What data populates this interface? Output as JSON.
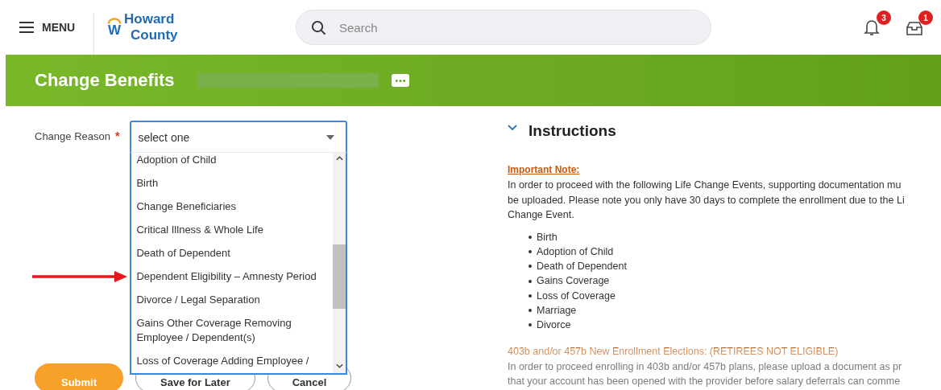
{
  "header": {
    "menu_label": "MENU",
    "logo": {
      "mark": "W",
      "lines": [
        "Howard",
        "County"
      ]
    },
    "search": {
      "placeholder": "Search"
    },
    "notifications": {
      "count": "3"
    },
    "inbox": {
      "count": "1"
    }
  },
  "banner": {
    "title": "Change Benefits"
  },
  "form": {
    "label": "Change Reason",
    "required": true,
    "required_mark": "*",
    "dropdown": {
      "value": "select one",
      "open": true,
      "options": [
        {
          "label": "Adoption of Child",
          "pointed": false
        },
        {
          "label": "Birth",
          "pointed": false
        },
        {
          "label": "Change Beneficiaries",
          "pointed": false
        },
        {
          "label": "Critical Illness & Whole Life",
          "pointed": false
        },
        {
          "label": "Death of Dependent",
          "pointed": false
        },
        {
          "label": "Dependent Eligibility – Amnesty Period",
          "pointed": true
        },
        {
          "label": "Divorce / Legal Separation",
          "pointed": false
        },
        {
          "label": "Gains Other Coverage Removing Employee / Dependent(s)",
          "pointed": false
        },
        {
          "label": "Loss of Coverage Adding Employee /",
          "pointed": false
        }
      ]
    }
  },
  "instructions": {
    "title": "Instructions",
    "expanded": true,
    "note_heading": "Important Note:",
    "note_lines": [
      "In order to proceed with the following Life Change Events, supporting documentation mu",
      "be uploaded. Please note you only have 30 days to complete the enrollment due to the Li",
      "Change Event."
    ],
    "events": [
      "Birth",
      "Adoption of Child",
      "Death of Dependent",
      "Gains Coverage",
      "Loss of Coverage",
      "Marriage",
      "Divorce"
    ],
    "section_heading": "403b and/or 457b New Enrollment Elections: (RETIREES NOT ELIGIBLE)",
    "section_lines": [
      "In order to proceed enrolling in 403b and/or 457b plans, please upload a document as pr",
      "that your account has been opened with the provider before salary deferrals can comme"
    ]
  },
  "buttons": [
    {
      "label": "Submit",
      "kind": "primary"
    },
    {
      "label": "Save for Later",
      "kind": "outline"
    },
    {
      "label": "Cancel",
      "kind": "outline"
    }
  ]
}
